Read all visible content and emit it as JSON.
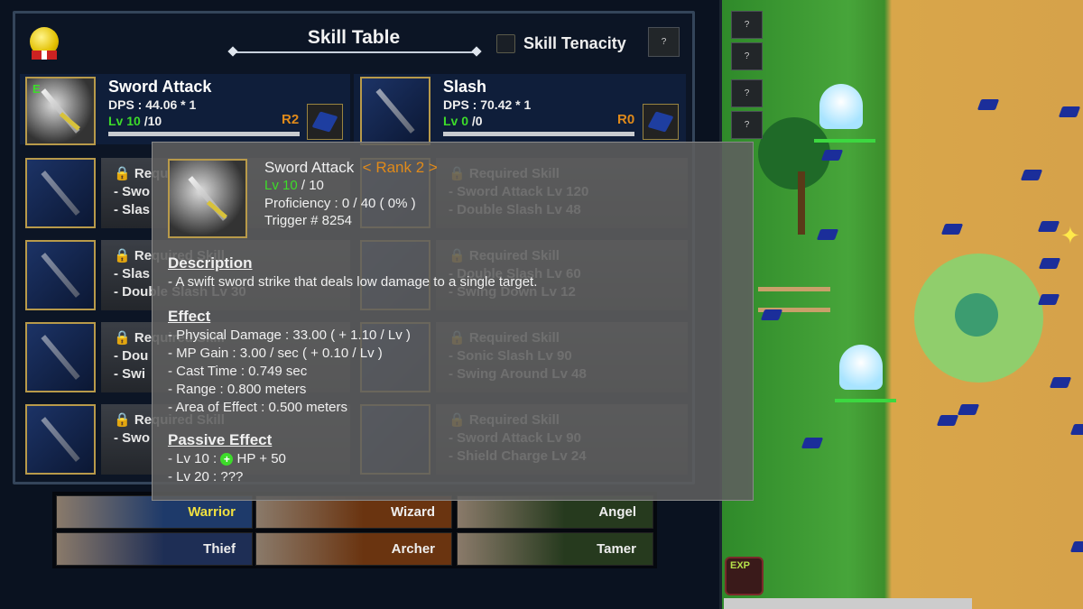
{
  "panel": {
    "title": "Skill Table",
    "tenacity_label": "Skill Tenacity",
    "help": "?"
  },
  "skills": [
    {
      "name": "Sword Attack",
      "dps": "DPS : 44.06 * 1",
      "lv": "Lv 10",
      "lv_max": "/10",
      "rank": "R2",
      "badge": "E",
      "progress": 1.0
    },
    {
      "name": "Slash",
      "dps": "DPS : 70.42 * 1",
      "lv": "Lv 0",
      "lv_max": "/0",
      "rank": "R0",
      "progress": 0
    }
  ],
  "locked_left": [
    {
      "l1": "Required Skill",
      "l2": "- Swo",
      "l3": "- Slas"
    },
    {
      "l1": "Required Skill",
      "l2": "- Slas",
      "l3": "- Double Slash Lv 30"
    },
    {
      "l1": "Required Skill",
      "l2": "- Dou",
      "l3": "- Swi"
    },
    {
      "l1": "Required Skill",
      "l2": "- Swo",
      "l3": ""
    }
  ],
  "locked_right": [
    {
      "l1": "Required Skill",
      "l2": "- Sword Attack Lv 120",
      "l3": "- Double Slash Lv 48"
    },
    {
      "l1": "Required Skill",
      "l2": "- Double Slash Lv 60",
      "l3": "- Swing Down Lv 12"
    },
    {
      "l1": "Required Skill",
      "l2": "- Sonic Slash Lv 90",
      "l3": "- Swing Around Lv 48"
    },
    {
      "l1": "Required Skill",
      "l2": "- Sword Attack Lv 90",
      "l3": "- Shield Charge Lv 24"
    }
  ],
  "tooltip": {
    "name": "Sword Attack",
    "rank": "< Rank 2 >",
    "lv": "Lv 10",
    "lv_max": " / 10",
    "proficiency": "Proficiency : 0 / 40 ( 0% )",
    "trigger": "Trigger # 8254",
    "desc_h": "Description",
    "desc": "- A swift sword strike that deals low damage to a single target.",
    "effect_h": "Effect",
    "effects": [
      "- Physical Damage : 33.00 ( + 1.10 / Lv )",
      "- MP Gain : 3.00 / sec  ( + 0.10 / Lv )",
      "- Cast Time : 0.749 sec",
      "- Range : 0.800 meters",
      "- Area of Effect : 0.500 meters"
    ],
    "passive_h": "Passive Effect",
    "passive1_pre": "- Lv 10 : ",
    "passive1_post": " HP + 50",
    "passive2": "- Lv 20 : ???"
  },
  "classes": [
    {
      "label": "Warrior",
      "color": "#1e3a6a",
      "active": true
    },
    {
      "label": "Wizard",
      "color": "#6a3410"
    },
    {
      "label": "Angel",
      "color": "#263a1e"
    },
    {
      "label": "Thief",
      "color": "#1e2e55"
    },
    {
      "label": "Archer",
      "color": "#6a3410"
    },
    {
      "label": "Tamer",
      "color": "#263a1e"
    }
  ],
  "game": {
    "help_buttons": [
      "?",
      "?",
      "?",
      "?"
    ],
    "exp_badge": "EXP"
  }
}
